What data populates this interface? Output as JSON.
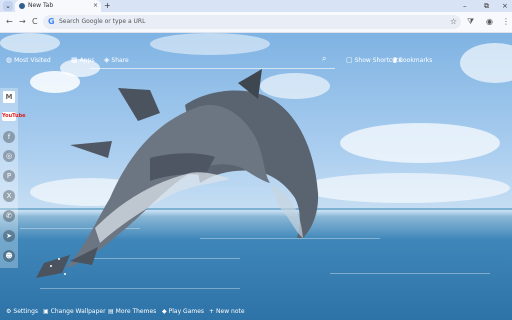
{
  "tabbar": {
    "tab_title": "New Tab",
    "close": "×",
    "new_tab": "+",
    "menu": "⌄",
    "min": "–",
    "max": "⧉",
    "close_window": "×"
  },
  "toolbar": {
    "back": "←",
    "forward": "→",
    "reload": "C",
    "omnibox_placeholder": "Search Google or type a URL",
    "google_g": "G",
    "star": "☆",
    "extensions": "⧩",
    "profile": "◉",
    "menu": "⋮"
  },
  "page": {
    "top_links": [
      {
        "label": "Most Visited",
        "icon": "globe-icon"
      },
      {
        "label": "Apps",
        "icon": "grid-icon"
      },
      {
        "label": "Share",
        "icon": "share-icon"
      }
    ],
    "show_shortcuts": "Show Shortcuts",
    "bookmarks": "Bookmarks",
    "sidebar": [
      {
        "name": "gmail-icon",
        "glyph": "M"
      },
      {
        "name": "youtube-icon",
        "glyph": "YouTube"
      },
      {
        "name": "facebook-icon",
        "glyph": "f"
      },
      {
        "name": "instagram-icon",
        "glyph": "◎"
      },
      {
        "name": "pinterest-icon",
        "glyph": "P"
      },
      {
        "name": "x-icon",
        "glyph": "X"
      },
      {
        "name": "whatsapp-icon",
        "glyph": "✆"
      },
      {
        "name": "telegram-icon",
        "glyph": "➤"
      },
      {
        "name": "reddit-icon",
        "glyph": "☻"
      }
    ],
    "bottom_links": [
      {
        "label": "Settings",
        "icon": "gear-icon"
      },
      {
        "label": "Change Wallpaper",
        "icon": "image-icon"
      },
      {
        "label": "More Themes",
        "icon": "palette-icon"
      },
      {
        "label": "Play Games",
        "icon": "gamepad-icon"
      },
      {
        "label": "New note",
        "icon": "plus-icon"
      }
    ]
  }
}
